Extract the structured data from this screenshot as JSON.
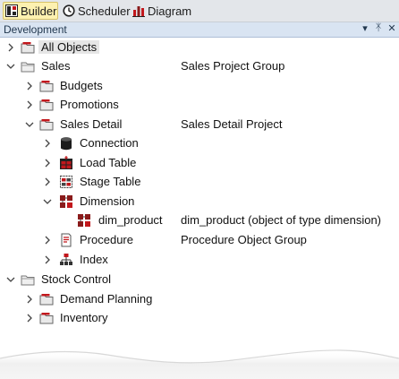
{
  "tabs": [
    {
      "label": "Builder",
      "icon": "builder-icon",
      "active": true
    },
    {
      "label": "Scheduler",
      "icon": "clock-icon",
      "active": false
    },
    {
      "label": "Diagram",
      "icon": "bar-chart-icon",
      "active": false
    }
  ],
  "panel": {
    "title": "Development",
    "menu_glyph": "▾",
    "pin_glyph": "ᛡ",
    "close_glyph": "✕"
  },
  "tree": {
    "rows": [
      {
        "label": "All Objects",
        "desc": "",
        "icon": "folder-icon",
        "expanded": false
      },
      {
        "label": "Sales",
        "desc": "Sales Project Group",
        "icon": "folder-icon",
        "expanded": true
      },
      {
        "label": "Budgets",
        "desc": "",
        "icon": "folder-icon",
        "expanded": false
      },
      {
        "label": "Promotions",
        "desc": "",
        "icon": "folder-icon",
        "expanded": false
      },
      {
        "label": "Sales Detail",
        "desc": "Sales Detail Project",
        "icon": "folder-icon",
        "expanded": true
      },
      {
        "label": "Connection",
        "desc": "",
        "icon": "database-icon",
        "expanded": false
      },
      {
        "label": "Load Table",
        "desc": "",
        "icon": "load-table-icon",
        "expanded": false
      },
      {
        "label": "Stage Table",
        "desc": "",
        "icon": "stage-table-icon",
        "expanded": false
      },
      {
        "label": "Dimension",
        "desc": "",
        "icon": "dimension-icon",
        "expanded": true
      },
      {
        "label": "dim_product",
        "desc": "dim_product (object of type dimension)",
        "icon": "dimension-icon",
        "expanded": false
      },
      {
        "label": "Procedure",
        "desc": "Procedure Object Group",
        "icon": "procedure-icon",
        "expanded": false
      },
      {
        "label": "Index",
        "desc": "",
        "icon": "index-icon",
        "expanded": false
      },
      {
        "label": "Stock Control",
        "desc": "",
        "icon": "folder-icon",
        "expanded": true
      },
      {
        "label": "Demand Planning",
        "desc": "",
        "icon": "folder-icon",
        "expanded": false
      },
      {
        "label": "Inventory",
        "desc": "",
        "icon": "folder-icon",
        "expanded": false
      }
    ]
  }
}
